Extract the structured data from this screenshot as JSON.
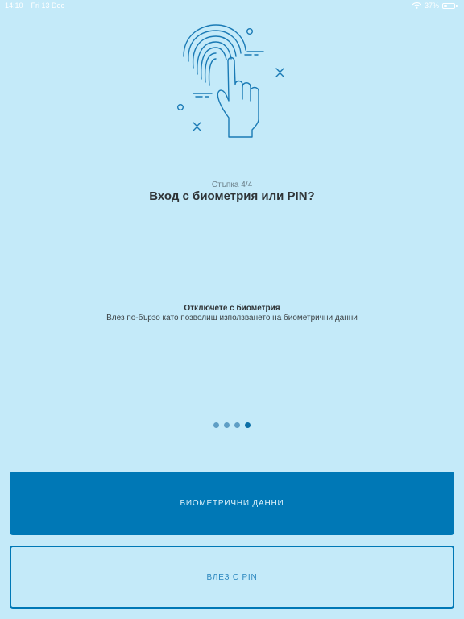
{
  "status_bar": {
    "time": "14:10",
    "date": "Fri 13 Dec",
    "battery": "37%",
    "battery_level": 0.37,
    "icons": [
      "wifi-icon",
      "battery-icon"
    ]
  },
  "onboarding": {
    "illustration": "fingerprint-hand-icon",
    "step_label": "Стъпка 4/4",
    "title": "Вход с биометрия или PIN?",
    "slide_heading": "Отключете с биометрия",
    "slide_description": "Влез по-бързо като позволиш използването на биометрични данни",
    "pagination": {
      "total": 4,
      "current": 4
    }
  },
  "actions": {
    "biometric_label": "Биометрични данни",
    "pin_label": "Влез с PIN"
  },
  "colors": {
    "background": "#c4eaf9",
    "accent": "#0078b6",
    "dot_inactive": "#5e9ec5",
    "dot_active": "#0b6fa7",
    "illustration_stroke": "#1a7ab5"
  }
}
